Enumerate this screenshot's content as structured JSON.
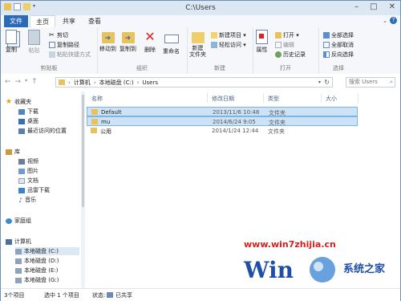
{
  "window": {
    "title": "C:\\Users"
  },
  "tabs": [
    {
      "label": "文件"
    },
    {
      "label": "主页"
    },
    {
      "label": "共享"
    },
    {
      "label": "查看"
    }
  ],
  "ribbon": {
    "clipboard": {
      "label": "剪贴板",
      "copy": "复制",
      "paste": "粘贴",
      "cut": "剪切",
      "copy_path": "复制路径",
      "paste_shortcut": "粘贴快捷方式"
    },
    "organize": {
      "label": "组织",
      "move_to": "移动到",
      "copy_to": "复制到",
      "delete": "删除",
      "rename": "重命名"
    },
    "new": {
      "label": "新建",
      "new_folder": "新建\n文件夹",
      "new_item": "新建项目 ▾",
      "easy_access": "轻松访问 ▾"
    },
    "open": {
      "label": "打开",
      "properties": "属性",
      "open": "打开 ▾",
      "edit": "编辑",
      "history": "历史记录"
    },
    "select": {
      "label": "选择",
      "select_all": "全部选择",
      "select_none": "全部取消",
      "invert": "反向选择"
    }
  },
  "address": {
    "segments": [
      "计算机",
      "本地磁盘 (C:)",
      "Users"
    ],
    "search_placeholder": "搜索 Users"
  },
  "nav": {
    "favorites": "收藏夹",
    "fav_items": [
      "下载",
      "桌面",
      "最近访问的位置"
    ],
    "library": "库",
    "lib_items": [
      "视频",
      "图片",
      "文档",
      "迅雷下载",
      "音乐"
    ],
    "homegroup": "家庭组",
    "computer": "计算机",
    "drives": [
      "本地磁盘 (C:)",
      "本地磁盘 (D:)",
      "本地磁盘 (E:)",
      "本地磁盘 (G:)"
    ]
  },
  "columns": {
    "name": "名称",
    "modified": "修改日期",
    "type": "类型",
    "size": "大小"
  },
  "files": [
    {
      "name": "Default",
      "modified": "2013/11/6 10:48",
      "type": "文件夹",
      "selected": true
    },
    {
      "name": "mu",
      "modified": "2014/6/24 9:05",
      "type": "文件夹",
      "selected": true
    },
    {
      "name": "公用",
      "modified": "2014/1/24 12:44",
      "type": "文件夹",
      "selected": false
    }
  ],
  "status": {
    "count": "3个项目",
    "selected": "选中 1 个项目",
    "state_label": "状态:",
    "state_value": "已共享"
  },
  "watermark": {
    "url": "www.win7zhijia.cn",
    "brand": "系统之家"
  },
  "colors": {
    "accent": "#2a6ab7",
    "selection": "#cce3f7",
    "folder": "#e8c25a",
    "watermark_red": "#d62020"
  }
}
